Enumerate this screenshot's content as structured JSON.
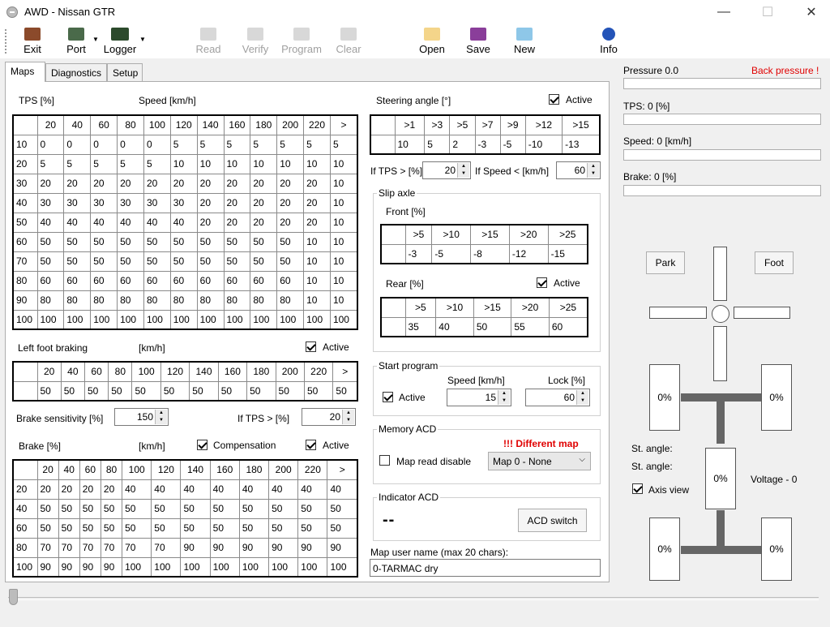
{
  "window": {
    "title": "AWD - Nissan GTR",
    "min": "—",
    "max": "☐",
    "close": "✕"
  },
  "toolbar": {
    "exit": "Exit",
    "port": "Port",
    "logger": "Logger",
    "read": "Read",
    "verify": "Verify",
    "program": "Program",
    "clear": "Clear",
    "open": "Open",
    "save": "Save",
    "new": "New",
    "info": "Info"
  },
  "tabs": [
    "Maps",
    "Diagnostics",
    "Setup"
  ],
  "tps_map": {
    "label": "TPS [%]",
    "speed_label": "Speed [km/h]",
    "header": [
      "",
      "20",
      "40",
      "60",
      "80",
      "100",
      "120",
      "140",
      "160",
      "180",
      "200",
      "220",
      ">"
    ],
    "rows": [
      [
        "10",
        "0",
        "0",
        "0",
        "0",
        "0",
        "5",
        "5",
        "5",
        "5",
        "5",
        "5",
        "5"
      ],
      [
        "20",
        "5",
        "5",
        "5",
        "5",
        "5",
        "10",
        "10",
        "10",
        "10",
        "10",
        "10",
        "10"
      ],
      [
        "30",
        "20",
        "20",
        "20",
        "20",
        "20",
        "20",
        "20",
        "20",
        "20",
        "20",
        "20",
        "10"
      ],
      [
        "40",
        "30",
        "30",
        "30",
        "30",
        "30",
        "30",
        "20",
        "20",
        "20",
        "20",
        "20",
        "10"
      ],
      [
        "50",
        "40",
        "40",
        "40",
        "40",
        "40",
        "40",
        "20",
        "20",
        "20",
        "20",
        "20",
        "10"
      ],
      [
        "60",
        "50",
        "50",
        "50",
        "50",
        "50",
        "50",
        "50",
        "50",
        "50",
        "50",
        "10",
        "10"
      ],
      [
        "70",
        "50",
        "50",
        "50",
        "50",
        "50",
        "50",
        "50",
        "50",
        "50",
        "50",
        "10",
        "10"
      ],
      [
        "80",
        "60",
        "60",
        "60",
        "60",
        "60",
        "60",
        "60",
        "60",
        "60",
        "60",
        "10",
        "10"
      ],
      [
        "90",
        "80",
        "80",
        "80",
        "80",
        "80",
        "80",
        "80",
        "80",
        "80",
        "80",
        "10",
        "10"
      ],
      [
        "100",
        "100",
        "100",
        "100",
        "100",
        "100",
        "100",
        "100",
        "100",
        "100",
        "100",
        "100",
        "100"
      ]
    ]
  },
  "left_foot": {
    "label": "Left foot braking",
    "unit": "[km/h]",
    "active": "Active",
    "header": [
      "",
      "20",
      "40",
      "60",
      "80",
      "100",
      "120",
      "140",
      "160",
      "180",
      "200",
      "220",
      ">"
    ],
    "row": [
      "",
      "50",
      "50",
      "50",
      "50",
      "50",
      "50",
      "50",
      "50",
      "50",
      "50",
      "50",
      "50"
    ]
  },
  "brake_sens": {
    "label": "Brake sensitivity [%]",
    "value": "150",
    "tps_label": "If TPS > [%]",
    "tps_value": "20"
  },
  "brake_map": {
    "label": "Brake [%]",
    "unit": "[km/h]",
    "compensation": "Compensation",
    "active": "Active",
    "header": [
      "",
      "20",
      "40",
      "60",
      "80",
      "100",
      "120",
      "140",
      "160",
      "180",
      "200",
      "220",
      ">"
    ],
    "rows": [
      [
        "20",
        "20",
        "20",
        "20",
        "20",
        "40",
        "40",
        "40",
        "40",
        "40",
        "40",
        "40",
        "40"
      ],
      [
        "40",
        "50",
        "50",
        "50",
        "50",
        "50",
        "50",
        "50",
        "50",
        "50",
        "50",
        "50",
        "50"
      ],
      [
        "60",
        "50",
        "50",
        "50",
        "50",
        "50",
        "50",
        "50",
        "50",
        "50",
        "50",
        "50",
        "50"
      ],
      [
        "80",
        "70",
        "70",
        "70",
        "70",
        "70",
        "70",
        "90",
        "90",
        "90",
        "90",
        "90",
        "90"
      ],
      [
        "100",
        "90",
        "90",
        "90",
        "90",
        "100",
        "100",
        "100",
        "100",
        "100",
        "100",
        "100",
        "100"
      ]
    ]
  },
  "steering": {
    "label": "Steering angle [°]",
    "active": "Active",
    "header": [
      "",
      ">1",
      ">3",
      ">5",
      ">7",
      ">9",
      ">12",
      ">15"
    ],
    "row": [
      "",
      "10",
      "5",
      "2",
      "-3",
      "-5",
      "-10",
      "-13"
    ],
    "tps_label": "If TPS > [%]",
    "tps_value": "20",
    "speed_label": "If Speed < [km/h]",
    "speed_value": "60"
  },
  "slip": {
    "label": "Slip axle",
    "front_label": "Front [%]",
    "rear_label": "Rear [%]",
    "active": "Active",
    "front_header": [
      "",
      ">5",
      ">10",
      ">15",
      ">20",
      ">25"
    ],
    "front_row": [
      "",
      "-3",
      "-5",
      "-8",
      "-12",
      "-15"
    ],
    "rear_header": [
      "",
      ">5",
      ">10",
      ">15",
      ">20",
      ">25"
    ],
    "rear_row": [
      "",
      "35",
      "40",
      "50",
      "55",
      "60"
    ]
  },
  "start_program": {
    "label": "Start program",
    "speed_label": "Speed [km/h]",
    "lock_label": "Lock [%]",
    "active": "Active",
    "speed_value": "15",
    "lock_value": "60"
  },
  "memory": {
    "label": "Memory ACD",
    "warning": "!!! Different map",
    "map_read_disable": "Map read disable",
    "map_select": "Map 0 - None"
  },
  "indicator": {
    "label": "Indicator ACD",
    "value": "--",
    "button": "ACD switch"
  },
  "user_name": {
    "label": "Map user name (max 20 chars):",
    "value": "0-TARMAC dry"
  },
  "status": {
    "pressure": "Pressure 0.0",
    "back_pressure": "Back pressure !",
    "tps": "TPS: 0 [%]",
    "speed": "Speed: 0 [km/h]",
    "brake": "Brake: 0 [%]"
  },
  "diagram": {
    "park": "Park",
    "foot": "Foot",
    "fl": "0%",
    "fr": "0%",
    "center": "0%",
    "rl": "0%",
    "rr": "0%",
    "st_angle1": "St. angle:",
    "st_angle2": "St. angle:",
    "axis_view": "Axis view",
    "voltage": "Voltage - 0"
  },
  "colors": {
    "warning": "#e00000",
    "shaft": "#666666"
  }
}
